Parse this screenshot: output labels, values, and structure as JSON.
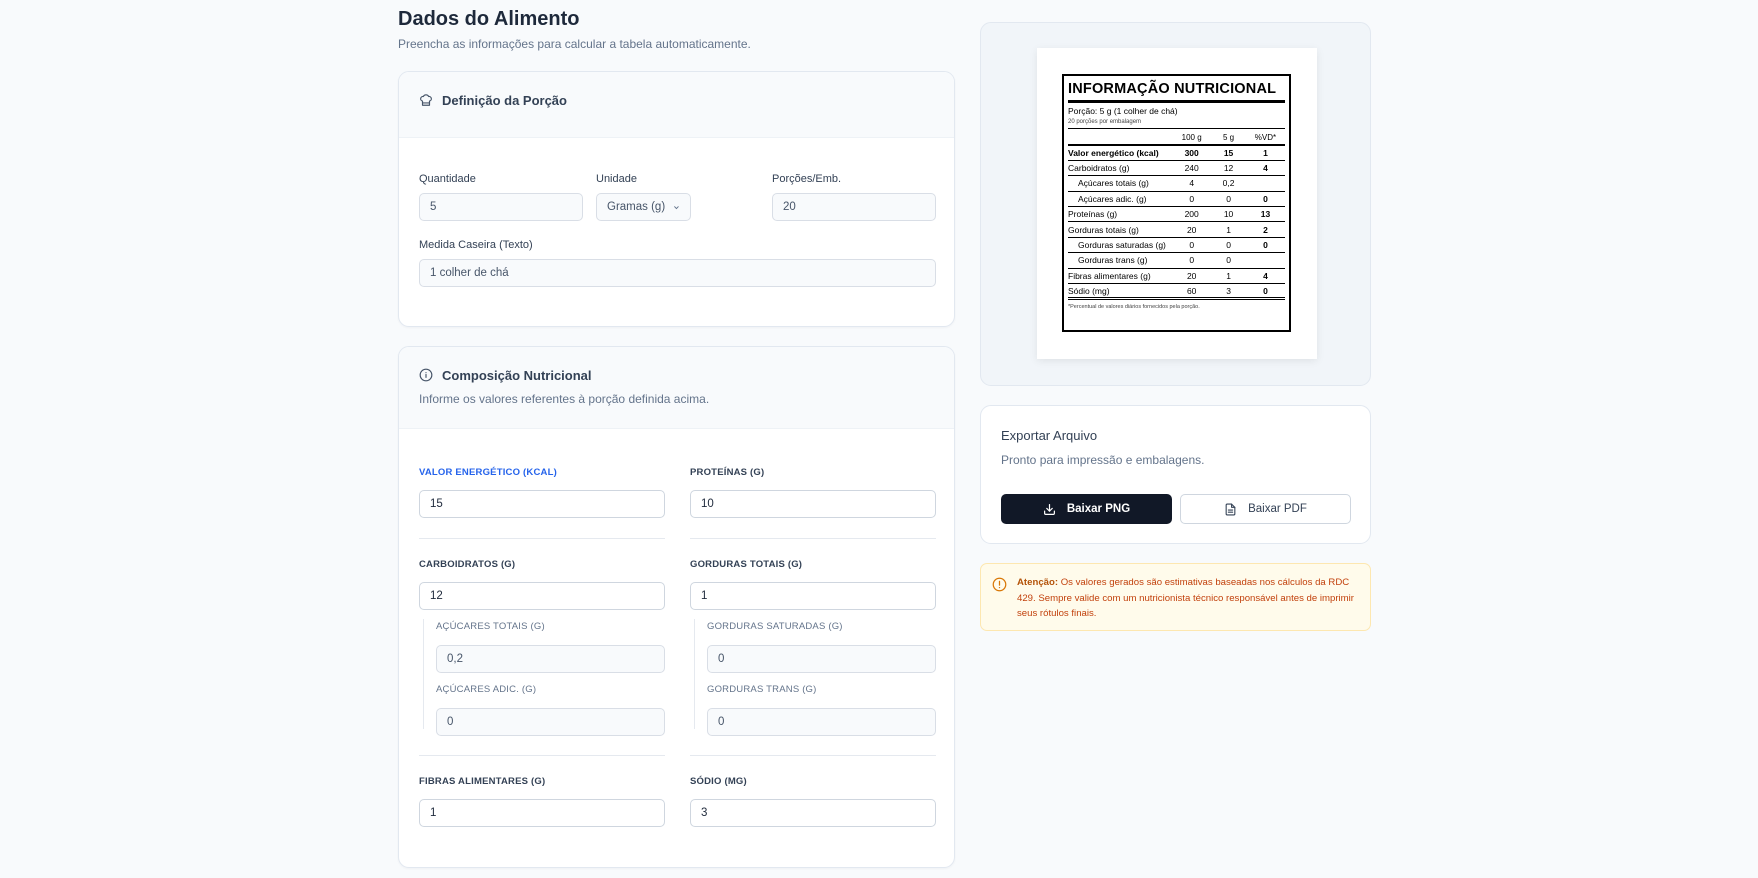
{
  "header": {
    "title": "Dados do Alimento",
    "subtitle": "Preencha as informações para calcular a tabela automaticamente."
  },
  "porcao": {
    "title": "Definição da Porção",
    "quantidade_label": "Quantidade",
    "quantidade_value": "5",
    "unidade_label": "Unidade",
    "unidade_value": "Gramas (g)",
    "porcoes_label": "Porções/Emb.",
    "porcoes_value": "20",
    "medida_label": "Medida Caseira (Texto)",
    "medida_value": "1 colher de chá"
  },
  "composicao": {
    "title": "Composição Nutricional",
    "description": "Informe os valores referentes à porção definida acima.",
    "energia_label": "VALOR ENERGÉTICO (KCAL)",
    "energia_value": "15",
    "proteinas_label": "PROTEÍNAS (G)",
    "proteinas_value": "10",
    "carboidratos_label": "CARBOIDRATOS (G)",
    "carboidratos_value": "12",
    "gorduras_label": "GORDURAS TOTAIS (G)",
    "gorduras_value": "1",
    "acucares_totais_label": "AÇÚCARES TOTAIS (G)",
    "acucares_totais_value": "0,2",
    "acucares_adic_label": "AÇÚCARES ADIC. (G)",
    "acucares_adic_value": "0",
    "gord_sat_label": "GORDURAS SATURADAS (G)",
    "gord_sat_value": "0",
    "gord_trans_label": "GORDURAS TRANS (G)",
    "gord_trans_value": "0",
    "fibras_label": "FIBRAS ALIMENTARES (G)",
    "fibras_value": "1",
    "sodio_label": "SÓDIO (MG)",
    "sodio_value": "3"
  },
  "label_preview": {
    "title": "INFORMAÇÃO NUTRICIONAL",
    "porcao": "Porção: 5 g (1 colher de chá)",
    "porcoes_emb": "20 porções por embalagem",
    "headers": [
      "",
      "100 g",
      "5 g",
      "%VD*"
    ],
    "rows": [
      {
        "name": "Valor energético (kcal)",
        "v100": "300",
        "vp": "15",
        "vd": "1"
      },
      {
        "name": "Carboidratos (g)",
        "v100": "240",
        "vp": "12",
        "vd": "4"
      },
      {
        "name": "Açúcares totais (g)",
        "v100": "4",
        "vp": "0,2",
        "vd": ""
      },
      {
        "name": "Açúcares adic. (g)",
        "v100": "0",
        "vp": "0",
        "vd": "0"
      },
      {
        "name": "Proteínas (g)",
        "v100": "200",
        "vp": "10",
        "vd": "13"
      },
      {
        "name": "Gorduras totais (g)",
        "v100": "20",
        "vp": "1",
        "vd": "2"
      },
      {
        "name": "Gorduras saturadas (g)",
        "v100": "0",
        "vp": "0",
        "vd": "0"
      },
      {
        "name": "Gorduras trans (g)",
        "v100": "0",
        "vp": "0",
        "vd": ""
      },
      {
        "name": "Fibras alimentares (g)",
        "v100": "20",
        "vp": "1",
        "vd": "4"
      },
      {
        "name": "Sódio (mg)",
        "v100": "60",
        "vp": "3",
        "vd": "0"
      }
    ],
    "footnote": "*Percentual de valores diários fornecidos pela porção."
  },
  "export": {
    "title": "Exportar Arquivo",
    "subtitle": "Pronto para impressão e embalagens.",
    "png_label": "Baixar PNG",
    "pdf_label": "Baixar PDF"
  },
  "warning": {
    "strong": "Atenção:",
    "text": " Os valores gerados são estimativas baseadas nos cálculos da RDC 429. Sempre valide com um nutricionista técnico responsável antes de imprimir seus rótulos finais."
  },
  "colors": {
    "accent_blue": "#2563eb",
    "button_dark": "#111827",
    "warning_bg": "#fffbeb",
    "warning_text": "#c2410c"
  },
  "icons": {
    "porcao": "chef-hat-icon",
    "composicao": "info-icon",
    "png": "download-icon",
    "pdf": "file-text-icon",
    "warning": "alert-circle-icon",
    "unidade": "chevron-down-icon"
  }
}
